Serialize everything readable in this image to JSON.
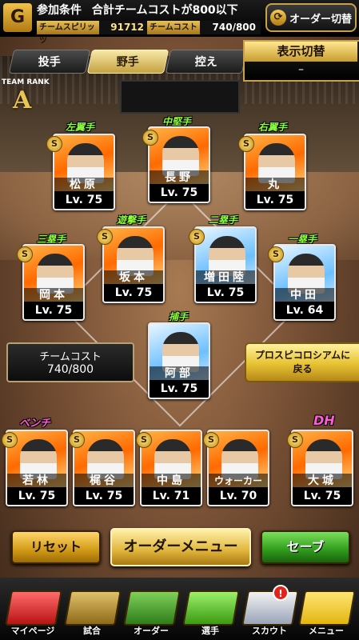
{
  "header": {
    "icon": "giants-emblem-icon",
    "condition_label": "参加条件",
    "condition_text": "合計チームコストが800以下",
    "spirit_label": "チームスピリッツ",
    "spirit_value": "91712",
    "cost_label": "チームコスト",
    "cost_value": "740/800",
    "order_switch_label": "オーダー切替"
  },
  "tabs": [
    {
      "label": "投手",
      "active": false
    },
    {
      "label": "野手",
      "active": true
    },
    {
      "label": "控え",
      "active": false
    }
  ],
  "display_switch": {
    "title": "表示切替",
    "value": "–"
  },
  "team_rank": {
    "label": "TEAM RANK",
    "value": "A"
  },
  "players": [
    {
      "position": "左翼手",
      "name": "松原",
      "level": "Lv. 75",
      "badge": "S"
    },
    {
      "position": "中堅手",
      "name": "長野",
      "level": "Lv. 75",
      "badge": "S"
    },
    {
      "position": "右翼手",
      "name": "丸",
      "level": "Lv. 75",
      "badge": "S"
    },
    {
      "position": "遊撃手",
      "name": "坂本",
      "level": "Lv. 75",
      "badge": "S"
    },
    {
      "position": "二塁手",
      "name": "増田陸",
      "level": "Lv. 75",
      "badge": "S"
    },
    {
      "position": "三塁手",
      "name": "岡本",
      "level": "Lv. 75",
      "badge": "S"
    },
    {
      "position": "一塁手",
      "name": "中田",
      "level": "Lv. 64",
      "badge": "S"
    },
    {
      "position": "捕手",
      "name": "阿部",
      "level": "Lv. 75",
      "badge": ""
    }
  ],
  "bench": {
    "label": "ベンチ",
    "players": [
      {
        "name": "若林",
        "level": "Lv. 75",
        "badge": "S"
      },
      {
        "name": "梶谷",
        "level": "Lv. 75",
        "badge": "S"
      },
      {
        "name": "中島",
        "level": "Lv. 71",
        "badge": "S"
      },
      {
        "name": "ウォーカー",
        "level": "Lv. 70",
        "badge": "S"
      }
    ]
  },
  "dh": {
    "label": "DH",
    "name": "大城",
    "level": "Lv. 75",
    "badge": "S"
  },
  "team_cost_box": {
    "title": "チームコスト",
    "value": "740/800"
  },
  "back_button": {
    "line1": "プロスピコロシアムに",
    "line2": "戻る"
  },
  "buttons": {
    "reset": "リセット",
    "order_menu": "オーダーメニュー",
    "save": "セーブ"
  },
  "nav": [
    {
      "label": "マイページ",
      "icon": "mypage-icon"
    },
    {
      "label": "試合",
      "icon": "stadium-icon"
    },
    {
      "label": "オーダー",
      "icon": "field-order-icon"
    },
    {
      "label": "選手",
      "icon": "player-icon"
    },
    {
      "label": "スカウト",
      "icon": "scout-icon"
    },
    {
      "label": "メニュー",
      "icon": "menu-icon"
    }
  ],
  "scout_alert": "!"
}
